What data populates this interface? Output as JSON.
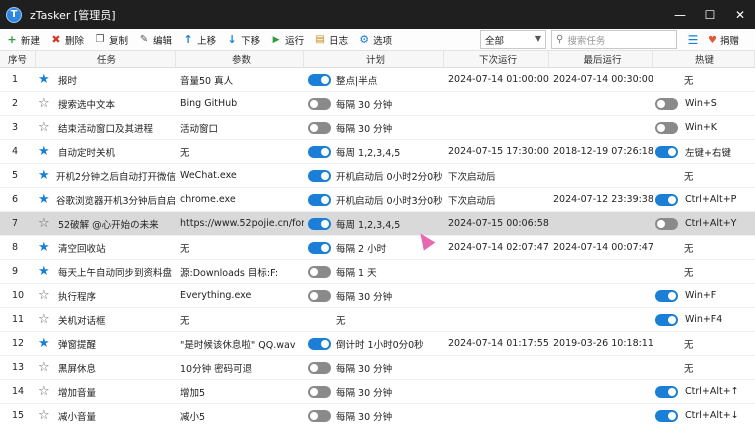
{
  "window": {
    "title": "zTasker [管理员]",
    "logo": "T",
    "minimize": "—",
    "maximize": "☐",
    "close": "✕"
  },
  "toolbar": {
    "new": "新建",
    "delete": "删除",
    "copy": "复制",
    "edit": "编辑",
    "move_up": "上移",
    "move_down": "下移",
    "run": "运行",
    "log": "日志",
    "options": "选项",
    "filter_value": "全部",
    "search_placeholder": "搜索任务",
    "donate": "捐赠"
  },
  "columns": {
    "idx": "序号",
    "task": "任务",
    "param": "参数",
    "plan": "计划",
    "next": "下次运行",
    "last": "最后运行",
    "hotkey": "热键"
  },
  "tasks": [
    {
      "idx": "1",
      "star": true,
      "name": "报时",
      "param": "音量50 真人",
      "plan_on": true,
      "plan": "整点|半点",
      "next": "2024-07-14 01:00:00",
      "last": "2024-07-14 00:30:00",
      "hot_toggle": null,
      "hotkey": "无"
    },
    {
      "idx": "2",
      "star": false,
      "name": "搜索选中文本",
      "param": "Bing GitHub",
      "plan_on": false,
      "plan": "每隔 30 分钟",
      "next": "",
      "last": "",
      "hot_toggle": false,
      "hotkey": "Win+S"
    },
    {
      "idx": "3",
      "star": false,
      "name": "结束活动窗口及其进程",
      "param": "活动窗口",
      "plan_on": false,
      "plan": "每隔 30 分钟",
      "next": "",
      "last": "",
      "hot_toggle": false,
      "hotkey": "Win+K"
    },
    {
      "idx": "4",
      "star": true,
      "name": "自动定时关机",
      "param": "无",
      "plan_on": true,
      "plan": "每周 1,2,3,4,5",
      "next": "2024-07-15 17:30:00",
      "last": "2018-12-19 07:26:18",
      "hot_toggle": true,
      "hotkey": "左键+右键"
    },
    {
      "idx": "5",
      "star": true,
      "name": "开机2分钟之后自动打开微信",
      "param": "WeChat.exe",
      "plan_on": true,
      "plan": "开机启动后 0小时2分0秒",
      "next": "下次启动后",
      "last": "",
      "hot_toggle": null,
      "hotkey": "无"
    },
    {
      "idx": "6",
      "star": true,
      "name": "谷歌浏览器开机3分钟后自启",
      "param": "chrome.exe",
      "plan_on": true,
      "plan": "开机启动后 0小时3分0秒",
      "next": "下次启动后",
      "last": "2024-07-12 23:39:38",
      "hot_toggle": true,
      "hotkey": "Ctrl+Alt+P"
    },
    {
      "idx": "7",
      "star": false,
      "name": "52破解 @心开始の未来",
      "param": "https://www.52pojie.cn/for...",
      "plan_on": true,
      "plan": "每周 1,2,3,4,5",
      "next": "2024-07-15 00:06:58",
      "last": "",
      "hot_toggle": false,
      "hotkey": "Ctrl+Alt+Y",
      "selected": true
    },
    {
      "idx": "8",
      "star": true,
      "name": "清空回收站",
      "param": "无",
      "plan_on": true,
      "plan": "每隔 2 小时",
      "next": "2024-07-14 02:07:47",
      "last": "2024-07-14 00:07:47",
      "hot_toggle": null,
      "hotkey": "无"
    },
    {
      "idx": "9",
      "star": true,
      "name": "每天上午自动同步到资料盘",
      "param": "源:Downloads 目标:F:",
      "plan_on": false,
      "plan": "每隔 1 天",
      "next": "",
      "last": "",
      "hot_toggle": null,
      "hotkey": "无"
    },
    {
      "idx": "10",
      "star": false,
      "name": "执行程序",
      "param": "Everything.exe",
      "plan_on": false,
      "plan": "每隔 30 分钟",
      "next": "",
      "last": "",
      "hot_toggle": true,
      "hotkey": "Win+F"
    },
    {
      "idx": "11",
      "star": false,
      "name": "关机对话框",
      "param": "无",
      "plan_on": null,
      "plan": "无",
      "next": "",
      "last": "",
      "hot_toggle": true,
      "hotkey": "Win+F4"
    },
    {
      "idx": "12",
      "star": true,
      "name": "弹窗提醒",
      "param": "\"是时候该休息啦\" QQ.wav",
      "plan_on": true,
      "plan": "倒计时 1小时0分0秒",
      "next": "2024-07-14 01:17:55",
      "last": "2019-03-26 10:18:11",
      "hot_toggle": null,
      "hotkey": "无"
    },
    {
      "idx": "13",
      "star": false,
      "name": "黑屏休息",
      "param": "10分钟 密码可退",
      "plan_on": false,
      "plan": "每隔 30 分钟",
      "next": "",
      "last": "",
      "hot_toggle": null,
      "hotkey": "无"
    },
    {
      "idx": "14",
      "star": false,
      "name": "增加音量",
      "param": "增加5",
      "plan_on": false,
      "plan": "每隔 30 分钟",
      "next": "",
      "last": "",
      "hot_toggle": true,
      "hotkey": "Ctrl+Alt+↑"
    },
    {
      "idx": "15",
      "star": false,
      "name": "减小音量",
      "param": "减小5",
      "plan_on": false,
      "plan": "每隔 30 分钟",
      "next": "",
      "last": "",
      "hot_toggle": true,
      "hotkey": "Ctrl+Alt+↓"
    }
  ],
  "colors": {
    "accent": "#1a7fd6",
    "titlebar": "#1f1f1f",
    "selected_row": "#d9d9d9"
  }
}
